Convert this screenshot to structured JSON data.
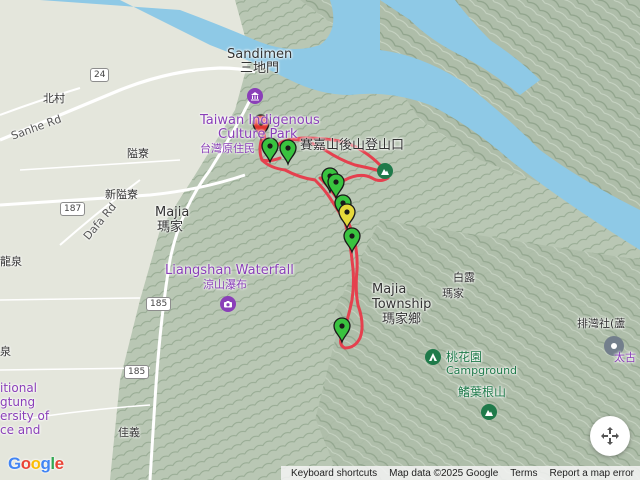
{
  "map": {
    "labels": {
      "sandimen_en": "Sandimen",
      "sandimen_zh": "三地門",
      "museum_en_1": "Taiwan Indigenous",
      "museum_en_2": "Culture Park",
      "museum_zh": "台灣原住民",
      "trailhead_zh": "賽嘉山後山登山口",
      "beicun": "北村",
      "sanhe_rd": "Sanhe Rd",
      "linjia": "隘寮",
      "xinlinjia": "新隘寮",
      "dafa_rd": "Dafa Rd",
      "majia_en": "Majia",
      "majia_zh": "瑪家",
      "waterfall_en": "Liangshan Waterfall",
      "waterfall_zh": "涼山瀑布",
      "township_en_1": "Majia",
      "township_en_2": "Township",
      "township_zh": "瑪家鄉",
      "bailu": "白露",
      "majia_right": "瑪家",
      "campground_zh": "桃花園",
      "campground_en": "Campground",
      "mountain_zh": "鰭葉根山",
      "paiwan_partial": "排灣社(蘆",
      "taigu_partial": "太古",
      "longquan": "龍泉",
      "jiayi": "佳義",
      "west_partial_1": "itional",
      "west_partial_2": "gtung",
      "west_partial_3": "ersity of",
      "west_partial_4": "ce and",
      "quan_partial": "泉",
      "shield_24": "24",
      "shield_187": "187",
      "shield_185_a": "185",
      "shield_185_b": "185"
    },
    "route": {
      "color": "#e5404e",
      "waypoint_count": 9,
      "waypoint_colors": {
        "green": "#39c33f",
        "yellow": "#e6d93a",
        "red": "#e0342d"
      }
    },
    "colors": {
      "water": "#8ec9e6",
      "urban": "#e4e6dc",
      "forest": "#b6c6b0",
      "road": "#ffffff",
      "poi": "#8a3fb8",
      "park": "#1f7a4a"
    },
    "icons": {
      "museum": "museum-icon",
      "waterfall": "camera-icon",
      "campground": "campground-icon",
      "mountain": "mountain-icon",
      "fullscreen": "fullscreen-icon",
      "place": "place-icon"
    }
  },
  "footer": {
    "keyboard": "Keyboard shortcuts",
    "data": "Map data ©2025 Google",
    "terms": "Terms",
    "report": "Report a map error"
  },
  "logo": {
    "letters": [
      "G",
      "o",
      "o",
      "g",
      "l",
      "e"
    ]
  }
}
